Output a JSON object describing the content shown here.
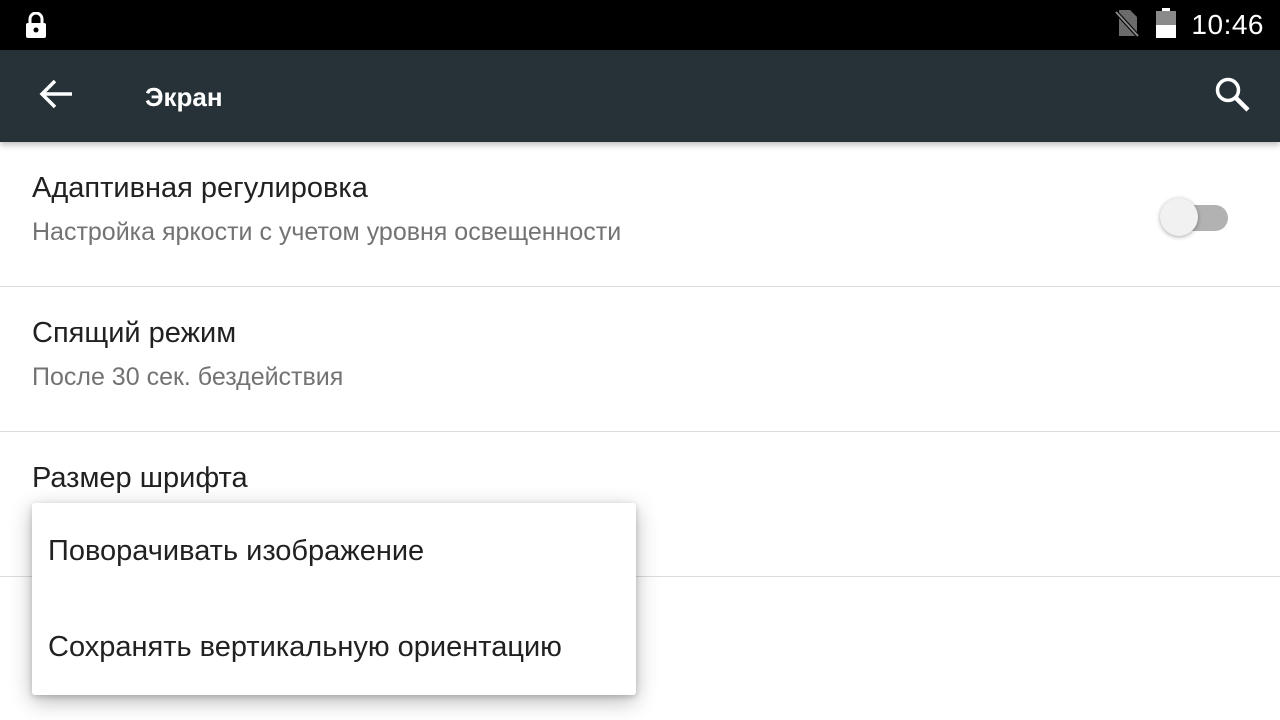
{
  "status_bar": {
    "time": "10:46",
    "icons": [
      "lock-icon",
      "no-sim-icon",
      "battery-icon"
    ]
  },
  "toolbar": {
    "title": "Экран",
    "back_icon": "arrow-back-icon",
    "search_icon": "search-icon"
  },
  "settings": {
    "items": [
      {
        "title": "Адаптивная регулировка",
        "summary": "Настройка яркости с учетом уровня освещенности",
        "toggle_on": false
      },
      {
        "title": "Спящий режим",
        "summary": "После 30 сек. бездействия"
      },
      {
        "title": "Размер шрифта"
      }
    ]
  },
  "popup_menu": {
    "items": [
      {
        "label": "Поворачивать изображение"
      },
      {
        "label": "Сохранять вертикальную ориентацию"
      }
    ]
  },
  "colors": {
    "status_bar": "#000000",
    "toolbar": "#263238",
    "toggle_track_off": "#b2b2b2",
    "toggle_thumb_off": "#f1f1f1",
    "summary_text": "#737373"
  }
}
